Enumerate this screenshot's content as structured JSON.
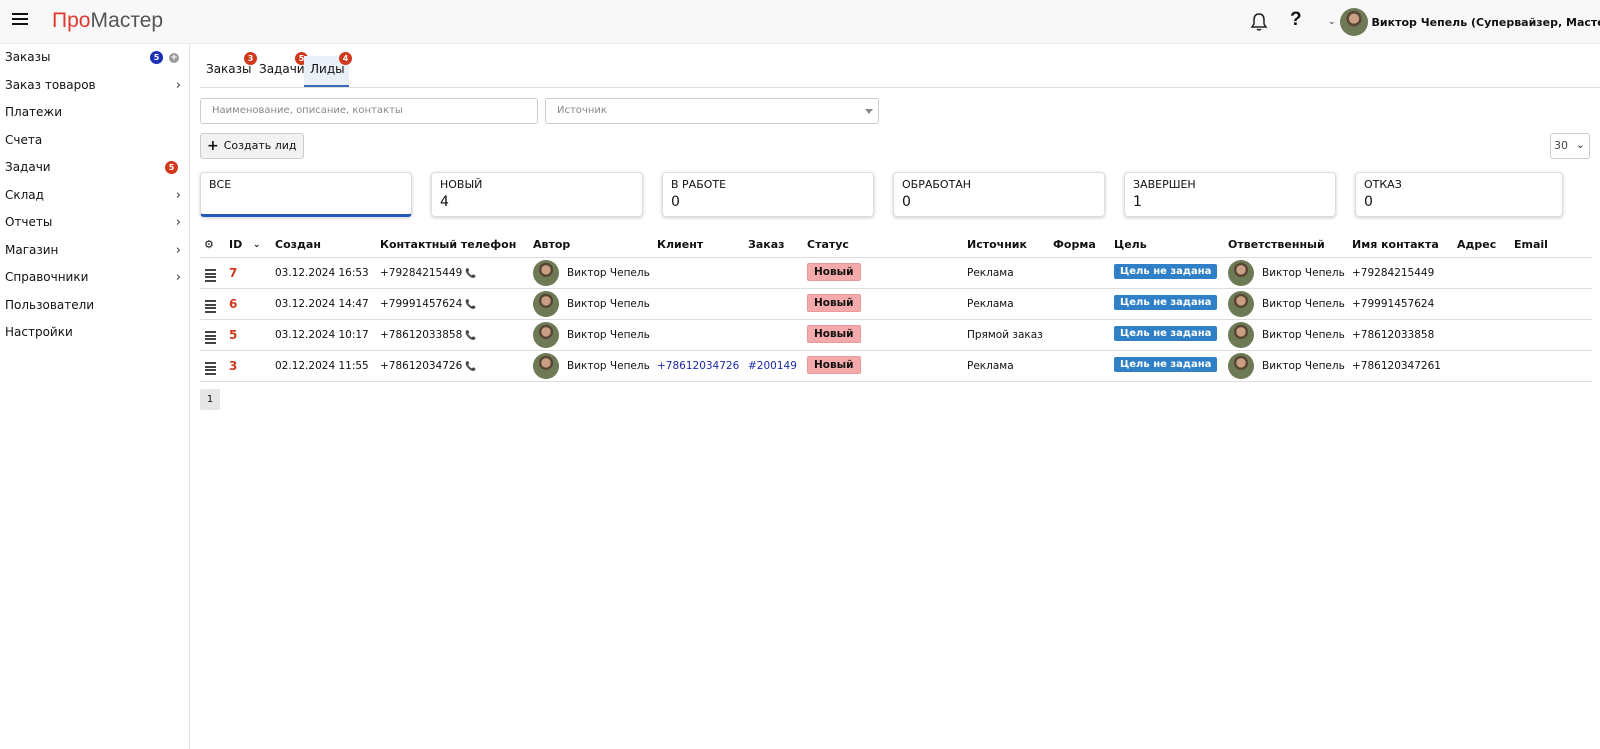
{
  "app": {
    "logo_part1": "Про",
    "logo_part2": "Мастер"
  },
  "user": {
    "name": "Виктор Чепель (Супервайзер, Мастер)"
  },
  "sidebar": {
    "items": [
      {
        "label": "Заказы",
        "badge": "5"
      },
      {
        "label": "Заказ товаров"
      },
      {
        "label": "Платежи"
      },
      {
        "label": "Счета"
      },
      {
        "label": "Задачи",
        "badge": "5"
      },
      {
        "label": "Склад"
      },
      {
        "label": "Отчеты"
      },
      {
        "label": "Магазин"
      },
      {
        "label": "Справочники"
      },
      {
        "label": "Пользователи"
      },
      {
        "label": "Настройки"
      }
    ]
  },
  "tabs": [
    {
      "label": "Заказы",
      "badge": "3"
    },
    {
      "label": "Задачи",
      "badge": "5"
    },
    {
      "label": "Лиды",
      "badge": "4"
    }
  ],
  "filters": {
    "search_placeholder": "Наименование, описание, контакты",
    "source_placeholder": "Источник"
  },
  "create_label": "Создать лид",
  "per_page": "30",
  "status_cards": [
    {
      "label": "ВСЕ",
      "value": ""
    },
    {
      "label": "НОВЫЙ",
      "value": "4"
    },
    {
      "label": "В РАБОТЕ",
      "value": "0"
    },
    {
      "label": "ОБРАБОТАН",
      "value": "0"
    },
    {
      "label": "ЗАВЕРШЕН",
      "value": "1"
    },
    {
      "label": "ОТКАЗ",
      "value": "0"
    }
  ],
  "columns": {
    "id": "ID",
    "created": "Создан",
    "phone": "Контактный телефон",
    "author": "Автор",
    "client": "Клиент",
    "order": "Заказ",
    "status": "Статус",
    "source": "Источник",
    "form": "Форма",
    "goal": "Цель",
    "responsible": "Ответственный",
    "contact_name": "Имя контакта",
    "address": "Адрес",
    "email": "Email"
  },
  "rows": [
    {
      "id": "7",
      "created": "03.12.2024 16:53",
      "phone": "+79284215449",
      "author": "Виктор Чепель",
      "client": "",
      "order": "",
      "status": "Новый",
      "source": "Реклама",
      "goal": "Цель не задана",
      "responsible": "Виктор Чепель",
      "contact_name": "+79284215449"
    },
    {
      "id": "6",
      "created": "03.12.2024 14:47",
      "phone": "+79991457624",
      "author": "Виктор Чепель",
      "client": "",
      "order": "",
      "status": "Новый",
      "source": "Реклама",
      "goal": "Цель не задана",
      "responsible": "Виктор Чепель",
      "contact_name": "+79991457624"
    },
    {
      "id": "5",
      "created": "03.12.2024 10:17",
      "phone": "+78612033858",
      "author": "Виктор Чепель",
      "client": "",
      "order": "",
      "status": "Новый",
      "source": "Прямой заказ",
      "goal": "Цель не задана",
      "responsible": "Виктор Чепель",
      "contact_name": "+78612033858"
    },
    {
      "id": "3",
      "created": "02.12.2024 11:55",
      "phone": "+78612034726",
      "author": "Виктор Чепель",
      "client": "+78612034726",
      "order": "#200149",
      "status": "Новый",
      "source": "Реклама",
      "goal": "Цель не задана",
      "responsible": "Виктор Чепель",
      "contact_name": "+786120347261"
    }
  ],
  "pagination": {
    "current": "1"
  }
}
